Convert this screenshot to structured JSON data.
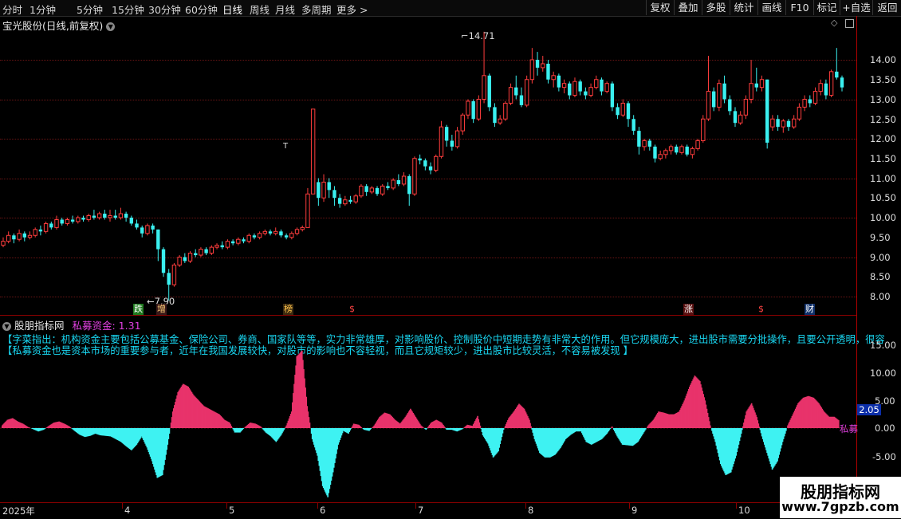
{
  "toolbar": {
    "periods": [
      "分时",
      "1分钟",
      "5分钟",
      "15分钟",
      "30分钟",
      "60分钟",
      "日线",
      "周线",
      "月线",
      "多周期",
      "更多 >"
    ],
    "active_period": "日线",
    "right_buttons": [
      "复权",
      "叠加",
      "多股",
      "统计",
      "画线",
      "F10",
      "标记",
      "+自选",
      "返回"
    ]
  },
  "stock": {
    "title": "宝光股份(日线,前复权)",
    "high_marker": "14.71",
    "low_marker": "7.90",
    "price_axis": [
      "14.00",
      "13.50",
      "13.00",
      "12.50",
      "12.00",
      "11.50",
      "11.00",
      "10.50",
      "10.00",
      "9.50",
      "9.00",
      "8.50",
      "8.00"
    ]
  },
  "event_marks": [
    {
      "text": "跌",
      "bg": "#1f7a1f",
      "fg": "#fff"
    },
    {
      "text": "增",
      "bg": "#3a1a1a",
      "fg": "#ffd27a"
    },
    {
      "text": "榜",
      "bg": "#3a2a10",
      "fg": "#ffc34a"
    },
    {
      "text": "$",
      "bg": "#000",
      "fg": "#ff4444"
    },
    {
      "text": "涨",
      "bg": "#5a1010",
      "fg": "#ffffff"
    },
    {
      "text": "$",
      "bg": "#000",
      "fg": "#ff4444"
    },
    {
      "text": "财",
      "bg": "#10306a",
      "fg": "#ffffff"
    }
  ],
  "indicator": {
    "site_name": "股朋指标网",
    "name_value": "私募资金: 1.31",
    "desc_line1": "【字菜指出：机构资金主要包括公募基金、保险公司、券商、国家队等等，实力非常雄厚，对影响股价、控制股价中短期走势有非常大的作用。但它规模庞大，进出股市需要分批操作，且要公开透明，很容",
    "desc_line2": "【私募资金也是资本市场的重要参与者，近年在我国发展较快，对股市的影响也不容轻视，而且它规矩较少，进出股市比较灵活，不容易被发现 】",
    "axis": [
      "15.00",
      "10.00",
      "5.00",
      "0.00",
      "-5.00"
    ],
    "current_value": "2.05",
    "line_label": "私募",
    "colors": {
      "positive": "#e8336b",
      "negative": "#3ef2f2"
    }
  },
  "dates": [
    "2025年",
    "4",
    "5",
    "6",
    "7",
    "8",
    "9",
    "10"
  ],
  "watermark": {
    "line1": "股朋指标网",
    "line2": "www.7gpzb.com"
  },
  "candle_colors": {
    "up": "#ff3d3d",
    "down": "#3af0f0"
  },
  "candles": [
    {
      "o": 9.3,
      "c": 9.4,
      "h": 9.5,
      "l": 9.25
    },
    {
      "o": 9.4,
      "c": 9.55,
      "h": 9.65,
      "l": 9.35
    },
    {
      "o": 9.55,
      "c": 9.45,
      "h": 9.6,
      "l": 9.35
    },
    {
      "o": 9.45,
      "c": 9.6,
      "h": 9.7,
      "l": 9.4
    },
    {
      "o": 9.6,
      "c": 9.5,
      "h": 9.65,
      "l": 9.4
    },
    {
      "o": 9.5,
      "c": 9.55,
      "h": 9.65,
      "l": 9.45
    },
    {
      "o": 9.55,
      "c": 9.7,
      "h": 9.75,
      "l": 9.5
    },
    {
      "o": 9.7,
      "c": 9.65,
      "h": 9.8,
      "l": 9.55
    },
    {
      "o": 9.65,
      "c": 9.85,
      "h": 9.9,
      "l": 9.6
    },
    {
      "o": 9.85,
      "c": 9.75,
      "h": 9.9,
      "l": 9.7
    },
    {
      "o": 9.75,
      "c": 9.95,
      "h": 10.05,
      "l": 9.7
    },
    {
      "o": 9.95,
      "c": 9.85,
      "h": 10.0,
      "l": 9.8
    },
    {
      "o": 9.85,
      "c": 9.95,
      "h": 10.0,
      "l": 9.8
    },
    {
      "o": 9.95,
      "c": 9.9,
      "h": 10.05,
      "l": 9.85
    },
    {
      "o": 9.9,
      "c": 10.0,
      "h": 10.05,
      "l": 9.85
    },
    {
      "o": 10.0,
      "c": 9.95,
      "h": 10.05,
      "l": 9.9
    },
    {
      "o": 9.95,
      "c": 10.05,
      "h": 10.1,
      "l": 9.9
    },
    {
      "o": 10.05,
      "c": 10.0,
      "h": 10.2,
      "l": 9.95
    },
    {
      "o": 10.0,
      "c": 10.1,
      "h": 10.15,
      "l": 9.95
    },
    {
      "o": 10.1,
      "c": 10.0,
      "h": 10.2,
      "l": 9.95
    },
    {
      "o": 10.0,
      "c": 10.05,
      "h": 10.2,
      "l": 9.9
    },
    {
      "o": 10.05,
      "c": 10.0,
      "h": 10.2,
      "l": 9.95
    },
    {
      "o": 10.0,
      "c": 10.1,
      "h": 10.25,
      "l": 9.95
    },
    {
      "o": 10.1,
      "c": 10.0,
      "h": 10.15,
      "l": 9.9
    },
    {
      "o": 10.0,
      "c": 9.85,
      "h": 10.05,
      "l": 9.8
    },
    {
      "o": 9.85,
      "c": 9.75,
      "h": 9.95,
      "l": 9.7
    },
    {
      "o": 9.75,
      "c": 9.6,
      "h": 9.8,
      "l": 9.5
    },
    {
      "o": 9.6,
      "c": 9.8,
      "h": 9.85,
      "l": 9.55
    },
    {
      "o": 9.8,
      "c": 9.7,
      "h": 9.85,
      "l": 9.6
    },
    {
      "o": 9.7,
      "c": 9.2,
      "h": 9.7,
      "l": 8.9
    },
    {
      "o": 9.2,
      "c": 8.6,
      "h": 9.25,
      "l": 8.5
    },
    {
      "o": 8.6,
      "c": 8.3,
      "h": 8.7,
      "l": 7.9
    },
    {
      "o": 8.3,
      "c": 8.8,
      "h": 8.85,
      "l": 8.25
    },
    {
      "o": 8.8,
      "c": 9.0,
      "h": 9.05,
      "l": 8.75
    },
    {
      "o": 9.0,
      "c": 8.9,
      "h": 9.1,
      "l": 8.85
    },
    {
      "o": 8.9,
      "c": 9.1,
      "h": 9.15,
      "l": 8.85
    },
    {
      "o": 9.1,
      "c": 9.05,
      "h": 9.2,
      "l": 9.0
    },
    {
      "o": 9.05,
      "c": 9.2,
      "h": 9.25,
      "l": 9.0
    },
    {
      "o": 9.2,
      "c": 9.1,
      "h": 9.25,
      "l": 9.05
    },
    {
      "o": 9.1,
      "c": 9.25,
      "h": 9.3,
      "l": 9.05
    },
    {
      "o": 9.25,
      "c": 9.3,
      "h": 9.35,
      "l": 9.2
    },
    {
      "o": 9.3,
      "c": 9.25,
      "h": 9.4,
      "l": 9.2
    },
    {
      "o": 9.25,
      "c": 9.4,
      "h": 9.45,
      "l": 9.2
    },
    {
      "o": 9.4,
      "c": 9.35,
      "h": 9.45,
      "l": 9.3
    },
    {
      "o": 9.35,
      "c": 9.45,
      "h": 9.5,
      "l": 9.3
    },
    {
      "o": 9.45,
      "c": 9.4,
      "h": 9.5,
      "l": 9.35
    },
    {
      "o": 9.4,
      "c": 9.55,
      "h": 9.6,
      "l": 9.35
    },
    {
      "o": 9.55,
      "c": 9.5,
      "h": 9.6,
      "l": 9.45
    },
    {
      "o": 9.5,
      "c": 9.6,
      "h": 9.65,
      "l": 9.45
    },
    {
      "o": 9.6,
      "c": 9.65,
      "h": 9.7,
      "l": 9.55
    },
    {
      "o": 9.65,
      "c": 9.6,
      "h": 9.7,
      "l": 9.55
    },
    {
      "o": 9.6,
      "c": 9.65,
      "h": 9.75,
      "l": 9.55
    },
    {
      "o": 9.65,
      "c": 9.55,
      "h": 9.7,
      "l": 9.5
    },
    {
      "o": 9.55,
      "c": 9.5,
      "h": 9.6,
      "l": 9.45
    },
    {
      "o": 9.5,
      "c": 9.6,
      "h": 9.65,
      "l": 9.45
    },
    {
      "o": 9.6,
      "c": 9.7,
      "h": 9.75,
      "l": 9.55
    },
    {
      "o": 9.7,
      "c": 9.75,
      "h": 9.8,
      "l": 9.65
    },
    {
      "o": 9.75,
      "c": 10.6,
      "h": 10.75,
      "l": 9.75
    },
    {
      "o": 10.6,
      "c": 12.75,
      "h": 12.75,
      "l": 10.6
    },
    {
      "o": 10.9,
      "c": 10.5,
      "h": 11.0,
      "l": 10.3
    },
    {
      "o": 10.5,
      "c": 10.9,
      "h": 11.1,
      "l": 10.4
    },
    {
      "o": 10.9,
      "c": 10.7,
      "h": 11.0,
      "l": 10.5
    },
    {
      "o": 10.7,
      "c": 10.5,
      "h": 10.8,
      "l": 10.3
    },
    {
      "o": 10.5,
      "c": 10.35,
      "h": 10.6,
      "l": 10.25
    },
    {
      "o": 10.35,
      "c": 10.45,
      "h": 10.55,
      "l": 10.3
    },
    {
      "o": 10.45,
      "c": 10.4,
      "h": 10.55,
      "l": 10.35
    },
    {
      "o": 10.4,
      "c": 10.55,
      "h": 10.6,
      "l": 10.35
    },
    {
      "o": 10.55,
      "c": 10.8,
      "h": 10.85,
      "l": 10.5
    },
    {
      "o": 10.8,
      "c": 10.65,
      "h": 10.85,
      "l": 10.55
    },
    {
      "o": 10.65,
      "c": 10.75,
      "h": 10.8,
      "l": 10.6
    },
    {
      "o": 10.75,
      "c": 10.6,
      "h": 10.8,
      "l": 10.55
    },
    {
      "o": 10.6,
      "c": 10.8,
      "h": 10.85,
      "l": 10.55
    },
    {
      "o": 10.8,
      "c": 10.75,
      "h": 10.9,
      "l": 10.7
    },
    {
      "o": 10.75,
      "c": 10.95,
      "h": 11.0,
      "l": 10.7
    },
    {
      "o": 10.95,
      "c": 10.85,
      "h": 11.1,
      "l": 10.8
    },
    {
      "o": 10.85,
      "c": 11.05,
      "h": 11.15,
      "l": 10.8
    },
    {
      "o": 11.05,
      "c": 10.6,
      "h": 11.1,
      "l": 10.3
    },
    {
      "o": 10.6,
      "c": 11.5,
      "h": 11.55,
      "l": 10.55
    },
    {
      "o": 11.5,
      "c": 11.45,
      "h": 11.6,
      "l": 11.35
    },
    {
      "o": 11.45,
      "c": 11.3,
      "h": 11.5,
      "l": 11.2
    },
    {
      "o": 11.3,
      "c": 11.2,
      "h": 11.4,
      "l": 11.1
    },
    {
      "o": 11.2,
      "c": 11.55,
      "h": 11.6,
      "l": 11.15
    },
    {
      "o": 11.55,
      "c": 12.3,
      "h": 12.45,
      "l": 11.5
    },
    {
      "o": 12.3,
      "c": 11.95,
      "h": 12.35,
      "l": 11.8
    },
    {
      "o": 11.95,
      "c": 11.8,
      "h": 12.1,
      "l": 11.7
    },
    {
      "o": 11.8,
      "c": 12.2,
      "h": 12.3,
      "l": 11.75
    },
    {
      "o": 12.2,
      "c": 12.6,
      "h": 12.65,
      "l": 12.1
    },
    {
      "o": 12.6,
      "c": 12.95,
      "h": 13.0,
      "l": 12.5
    },
    {
      "o": 12.95,
      "c": 12.5,
      "h": 13.0,
      "l": 12.4
    },
    {
      "o": 12.5,
      "c": 13.0,
      "h": 13.1,
      "l": 12.45
    },
    {
      "o": 13.0,
      "c": 13.6,
      "h": 14.71,
      "l": 12.9
    },
    {
      "o": 13.6,
      "c": 12.8,
      "h": 13.65,
      "l": 12.7
    },
    {
      "o": 12.8,
      "c": 12.4,
      "h": 12.9,
      "l": 12.3
    },
    {
      "o": 12.4,
      "c": 12.5,
      "h": 12.6,
      "l": 12.35
    },
    {
      "o": 12.5,
      "c": 12.9,
      "h": 12.95,
      "l": 12.45
    },
    {
      "o": 12.9,
      "c": 13.3,
      "h": 13.4,
      "l": 12.85
    },
    {
      "o": 13.3,
      "c": 13.1,
      "h": 13.6,
      "l": 13.0
    },
    {
      "o": 13.1,
      "c": 12.85,
      "h": 13.3,
      "l": 12.8
    },
    {
      "o": 12.85,
      "c": 13.5,
      "h": 13.6,
      "l": 12.8
    },
    {
      "o": 13.5,
      "c": 14.0,
      "h": 14.3,
      "l": 13.4
    },
    {
      "o": 14.0,
      "c": 13.8,
      "h": 14.2,
      "l": 13.6
    },
    {
      "o": 13.8,
      "c": 13.9,
      "h": 14.1,
      "l": 13.7
    },
    {
      "o": 13.9,
      "c": 13.5,
      "h": 14.0,
      "l": 13.4
    },
    {
      "o": 13.5,
      "c": 13.6,
      "h": 13.7,
      "l": 13.3
    },
    {
      "o": 13.6,
      "c": 13.3,
      "h": 13.65,
      "l": 13.2
    },
    {
      "o": 13.3,
      "c": 13.4,
      "h": 13.5,
      "l": 13.15
    },
    {
      "o": 13.4,
      "c": 13.1,
      "h": 13.45,
      "l": 13.0
    },
    {
      "o": 13.1,
      "c": 13.45,
      "h": 13.55,
      "l": 13.05
    },
    {
      "o": 13.45,
      "c": 13.2,
      "h": 13.5,
      "l": 13.1
    },
    {
      "o": 13.2,
      "c": 13.1,
      "h": 13.3,
      "l": 13.0
    },
    {
      "o": 13.1,
      "c": 13.3,
      "h": 13.4,
      "l": 13.05
    },
    {
      "o": 13.3,
      "c": 13.5,
      "h": 13.6,
      "l": 13.25
    },
    {
      "o": 13.5,
      "c": 13.2,
      "h": 13.55,
      "l": 13.1
    },
    {
      "o": 13.2,
      "c": 13.4,
      "h": 13.45,
      "l": 13.15
    },
    {
      "o": 13.4,
      "c": 12.8,
      "h": 13.45,
      "l": 12.7
    },
    {
      "o": 12.8,
      "c": 12.6,
      "h": 12.9,
      "l": 12.5
    },
    {
      "o": 12.6,
      "c": 12.9,
      "h": 13.0,
      "l": 12.55
    },
    {
      "o": 12.9,
      "c": 12.5,
      "h": 12.95,
      "l": 12.3
    },
    {
      "o": 12.5,
      "c": 12.2,
      "h": 12.6,
      "l": 12.1
    },
    {
      "o": 12.2,
      "c": 11.8,
      "h": 12.3,
      "l": 11.6
    },
    {
      "o": 11.8,
      "c": 11.95,
      "h": 12.0,
      "l": 11.7
    },
    {
      "o": 11.95,
      "c": 11.8,
      "h": 12.0,
      "l": 11.7
    },
    {
      "o": 11.8,
      "c": 11.5,
      "h": 11.85,
      "l": 11.4
    },
    {
      "o": 11.5,
      "c": 11.6,
      "h": 11.7,
      "l": 11.45
    },
    {
      "o": 11.6,
      "c": 11.7,
      "h": 11.75,
      "l": 11.5
    },
    {
      "o": 11.7,
      "c": 11.8,
      "h": 11.85,
      "l": 11.6
    },
    {
      "o": 11.8,
      "c": 11.65,
      "h": 11.85,
      "l": 11.6
    },
    {
      "o": 11.65,
      "c": 11.8,
      "h": 11.85,
      "l": 11.6
    },
    {
      "o": 11.8,
      "c": 11.6,
      "h": 11.85,
      "l": 11.55
    },
    {
      "o": 11.6,
      "c": 11.75,
      "h": 11.8,
      "l": 11.5
    },
    {
      "o": 11.75,
      "c": 11.95,
      "h": 12.0,
      "l": 11.7
    },
    {
      "o": 11.95,
      "c": 12.5,
      "h": 12.6,
      "l": 11.9
    },
    {
      "o": 12.5,
      "c": 13.2,
      "h": 14.1,
      "l": 12.45
    },
    {
      "o": 13.2,
      "c": 12.8,
      "h": 13.3,
      "l": 12.7
    },
    {
      "o": 12.8,
      "c": 13.4,
      "h": 13.5,
      "l": 12.7
    },
    {
      "o": 13.4,
      "c": 13.0,
      "h": 13.6,
      "l": 12.9
    },
    {
      "o": 13.0,
      "c": 12.7,
      "h": 13.1,
      "l": 12.6
    },
    {
      "o": 12.7,
      "c": 12.4,
      "h": 12.8,
      "l": 12.3
    },
    {
      "o": 12.4,
      "c": 12.6,
      "h": 12.7,
      "l": 12.35
    },
    {
      "o": 12.6,
      "c": 13.0,
      "h": 13.1,
      "l": 12.5
    },
    {
      "o": 13.0,
      "c": 13.4,
      "h": 14.0,
      "l": 12.9
    },
    {
      "o": 13.4,
      "c": 13.3,
      "h": 13.8,
      "l": 13.2
    },
    {
      "o": 13.3,
      "c": 13.5,
      "h": 13.6,
      "l": 13.2
    },
    {
      "o": 13.5,
      "c": 11.9,
      "h": 13.5,
      "l": 11.75
    },
    {
      "o": 12.3,
      "c": 12.5,
      "h": 12.6,
      "l": 12.2
    },
    {
      "o": 12.5,
      "c": 12.3,
      "h": 12.6,
      "l": 12.2
    },
    {
      "o": 12.3,
      "c": 12.45,
      "h": 12.5,
      "l": 12.15
    },
    {
      "o": 12.45,
      "c": 12.3,
      "h": 12.5,
      "l": 12.2
    },
    {
      "o": 12.3,
      "c": 12.5,
      "h": 12.6,
      "l": 12.25
    },
    {
      "o": 12.5,
      "c": 12.8,
      "h": 12.9,
      "l": 12.45
    },
    {
      "o": 12.8,
      "c": 13.0,
      "h": 13.1,
      "l": 12.7
    },
    {
      "o": 13.0,
      "c": 12.9,
      "h": 13.1,
      "l": 12.8
    },
    {
      "o": 12.9,
      "c": 13.2,
      "h": 13.3,
      "l": 12.85
    },
    {
      "o": 13.2,
      "c": 13.4,
      "h": 13.5,
      "l": 13.1
    },
    {
      "o": 13.4,
      "c": 13.1,
      "h": 13.5,
      "l": 13.0
    },
    {
      "o": 13.1,
      "c": 13.7,
      "h": 13.75,
      "l": 13.05
    },
    {
      "o": 13.7,
      "c": 13.55,
      "h": 14.3,
      "l": 13.5
    },
    {
      "o": 13.55,
      "c": 13.3,
      "h": 13.6,
      "l": 13.2
    }
  ],
  "indicator_series": [
    0.5,
    1.5,
    1.8,
    1.2,
    0.8,
    0.2,
    -0.2,
    -0.6,
    -0.3,
    0.4,
    1.0,
    1.2,
    0.8,
    0.3,
    -0.5,
    -1.2,
    -1.6,
    -1.4,
    -1.0,
    -1.3,
    -1.4,
    -1.5,
    -2.0,
    -2.5,
    -3.3,
    -4.0,
    -3.0,
    -1.5,
    -3.5,
    -6.0,
    -9.0,
    -8.5,
    -3.0,
    3.0,
    6.5,
    8.0,
    7.5,
    6.0,
    5.0,
    4.0,
    3.5,
    3.0,
    2.5,
    1.5,
    1.0,
    -0.8,
    -0.8,
    0.2,
    1.0,
    0.8,
    0.3,
    -0.8,
    -1.5,
    -2.5,
    -1.2,
    0.5,
    3.0,
    13.0,
    14.0,
    4.0,
    -2.0,
    -5.0,
    -10.5,
    -12.5,
    -8.0,
    -3.0,
    -0.5,
    -1.0,
    0.8,
    0.6,
    -0.3,
    -0.5,
    0.5,
    2.0,
    2.8,
    2.5,
    1.5,
    0.8,
    2.0,
    3.5,
    2.0,
    0.5,
    -0.3,
    1.0,
    1.5,
    1.0,
    -0.3,
    -0.3,
    -0.6,
    -0.2,
    0.6,
    0.4,
    2.2,
    -1.3,
    -2.8,
    -5.3,
    -4.2,
    -0.3,
    1.8,
    3.0,
    4.4,
    3.5,
    1.5,
    -2.0,
    -4.5,
    -5.3,
    -5.3,
    -4.8,
    -3.6,
    -2.0,
    -1.2,
    -0.6,
    -0.6,
    -2.5,
    -3.0,
    -2.5,
    -2.0,
    -1.0,
    0.3,
    -1.5,
    -3.0,
    -3.1,
    -3.2,
    -2.5,
    -1.0,
    0.5,
    1.5,
    3.0,
    2.8,
    2.5,
    2.5,
    3.0,
    5.0,
    7.5,
    9.5,
    8.5,
    5.0,
    0.5,
    -2.5,
    -6.5,
    -8.5,
    -8.0,
    -5.0,
    -1.0,
    3.0,
    4.5,
    2.0,
    -1.5,
    -4.5,
    -7.5,
    -6.0,
    -2.5,
    0.5,
    2.5,
    4.5,
    5.5,
    5.8,
    5.5,
    4.5,
    3.0,
    2.05,
    2.05,
    1.31
  ]
}
